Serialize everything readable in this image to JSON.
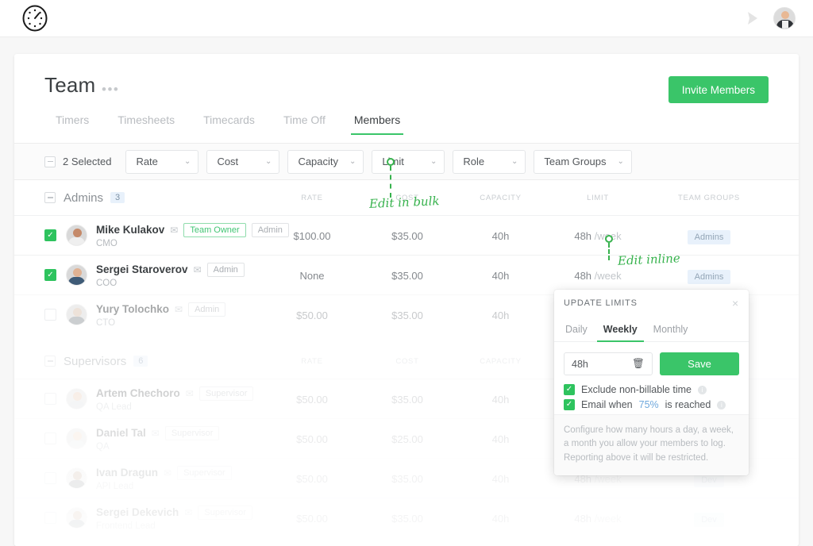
{
  "topbar": {
    "logo_icon": "timer-clock-icon",
    "send_icon": "send-arrow-icon",
    "avatar_icon": "user-avatar"
  },
  "header": {
    "title": "Team",
    "more_label": "•••",
    "invite_button": "Invite Members"
  },
  "tabs": [
    {
      "label": "Timers",
      "active": false
    },
    {
      "label": "Timesheets",
      "active": false
    },
    {
      "label": "Timecards",
      "active": false
    },
    {
      "label": "Time Off",
      "active": false
    },
    {
      "label": "Members",
      "active": true
    }
  ],
  "filterbar": {
    "selected_label": "2 Selected",
    "filters": [
      {
        "label": "Rate"
      },
      {
        "label": "Cost"
      },
      {
        "label": "Capacity"
      },
      {
        "label": "Limit"
      },
      {
        "label": "Role"
      },
      {
        "label": "Team Groups"
      }
    ],
    "chevron": "⌄"
  },
  "columns": {
    "rate": "RATE",
    "cost": "COST",
    "capacity": "CAPACITY",
    "limit": "LIMIT",
    "team_groups": "TEAM GROUPS"
  },
  "groups": [
    {
      "name": "Admins",
      "count": "3"
    },
    {
      "name": "Supervisors",
      "count": "6"
    }
  ],
  "members": [
    {
      "name": "Mike Kulakov",
      "role": "CMO",
      "badges": [
        "Team Owner",
        "Admin"
      ],
      "rate": "$100.00",
      "cost": "$35.00",
      "capacity": "40h",
      "limit_value": "48h",
      "limit_unit": "/week",
      "team_group": "Admins",
      "selected": true
    },
    {
      "name": "Sergei Staroverov",
      "role": "COO",
      "badges": [
        "Admin"
      ],
      "rate": "None",
      "cost": "$35.00",
      "capacity": "40h",
      "limit_value": "48h",
      "limit_unit": "/week",
      "team_group": "Admins",
      "selected": true
    },
    {
      "name": "Yury Tolochko",
      "role": "CTO",
      "badges": [
        "Admin"
      ],
      "rate": "$50.00",
      "cost": "$35.00",
      "capacity": "40h",
      "limit_value": "",
      "limit_unit": "",
      "team_group": "",
      "selected": false
    },
    {
      "name": "Artem Chechoro",
      "role": "QA Lead",
      "badges": [
        "Supervisor"
      ],
      "rate": "$50.00",
      "cost": "$35.00",
      "capacity": "40h",
      "limit_value": "",
      "limit_unit": "",
      "team_group": "",
      "selected": false
    },
    {
      "name": "Daniel Tal",
      "role": "QA",
      "badges": [
        "Supervisor"
      ],
      "rate": "$50.00",
      "cost": "$25.00",
      "capacity": "40h",
      "limit_value": "",
      "limit_unit": "",
      "team_group": "",
      "selected": false
    },
    {
      "name": "Ivan Dragun",
      "role": "API Lead",
      "badges": [
        "Supervisor"
      ],
      "rate": "$50.00",
      "cost": "$35.00",
      "capacity": "40h",
      "limit_value": "48h",
      "limit_unit": "/week",
      "team_group": "Dev",
      "selected": false
    },
    {
      "name": "Sergei Dekevich",
      "role": "Frontend Lead",
      "badges": [
        "Supervisor"
      ],
      "rate": "$50.00",
      "cost": "$35.00",
      "capacity": "40h",
      "limit_value": "48h",
      "limit_unit": "/week",
      "team_group": "Dev",
      "selected": false
    }
  ],
  "popup": {
    "title": "UPDATE LIMITS",
    "close": "×",
    "tabs": [
      {
        "label": "Daily",
        "active": false
      },
      {
        "label": "Weekly",
        "active": true
      },
      {
        "label": "Monthly",
        "active": false
      }
    ],
    "input_value": "48h",
    "save_label": "Save",
    "checkbox_exclude": "Exclude non-billable time",
    "checkbox_email_prefix": "Email when",
    "checkbox_email_percent": "75%",
    "checkbox_email_suffix": "is reached",
    "note": "Configure how many hours a day, a week, a month you allow your members to log. Reporting above it will be restricted."
  },
  "annotations": {
    "bulk": "Edit in bulk",
    "inline": "Edit inline"
  },
  "colors": {
    "accent_green": "#3ac569",
    "annotation_green": "#37b24d",
    "badge_blue": "#e8f1fb",
    "percent_blue": "#6fa8dc"
  }
}
